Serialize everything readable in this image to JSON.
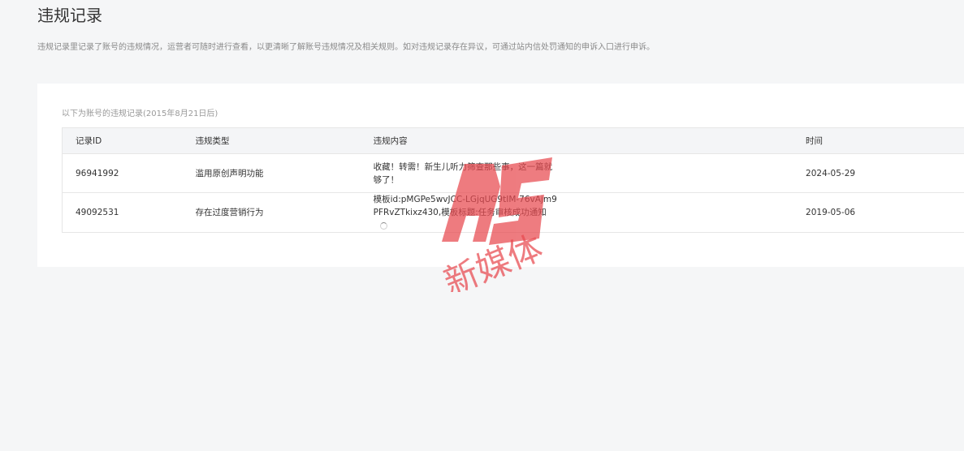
{
  "page": {
    "title": "违规记录",
    "description": "违规记录里记录了账号的违规情况，运营者可随时进行查看，以更清晰了解账号违规情况及相关规则。如对违规记录存在异议，可通过站内信处罚通知的申诉入口进行申诉。"
  },
  "records": {
    "note": "以下为账号的违规记录(2015年8月21日后)",
    "columns": {
      "id": "记录ID",
      "type": "违规类型",
      "content": "违规内容",
      "time": "时间"
    },
    "rows": [
      {
        "id": "96941992",
        "type": "滥用原创声明功能",
        "content": "收藏！转需！新生儿听力筛查那些事，这一篇就够了！",
        "time": "2024-05-29"
      },
      {
        "id": "49092531",
        "type": "存在过度营销行为",
        "content": "模板id:pMGPe5wvJCC-LGjqUG9tIM-76vAjm9PFRvZTkixz430,模板标题:任务审核成功通知",
        "time": "2019-05-06"
      }
    ]
  },
  "watermark": {
    "text": "新媒体",
    "color": "#e8494f"
  }
}
